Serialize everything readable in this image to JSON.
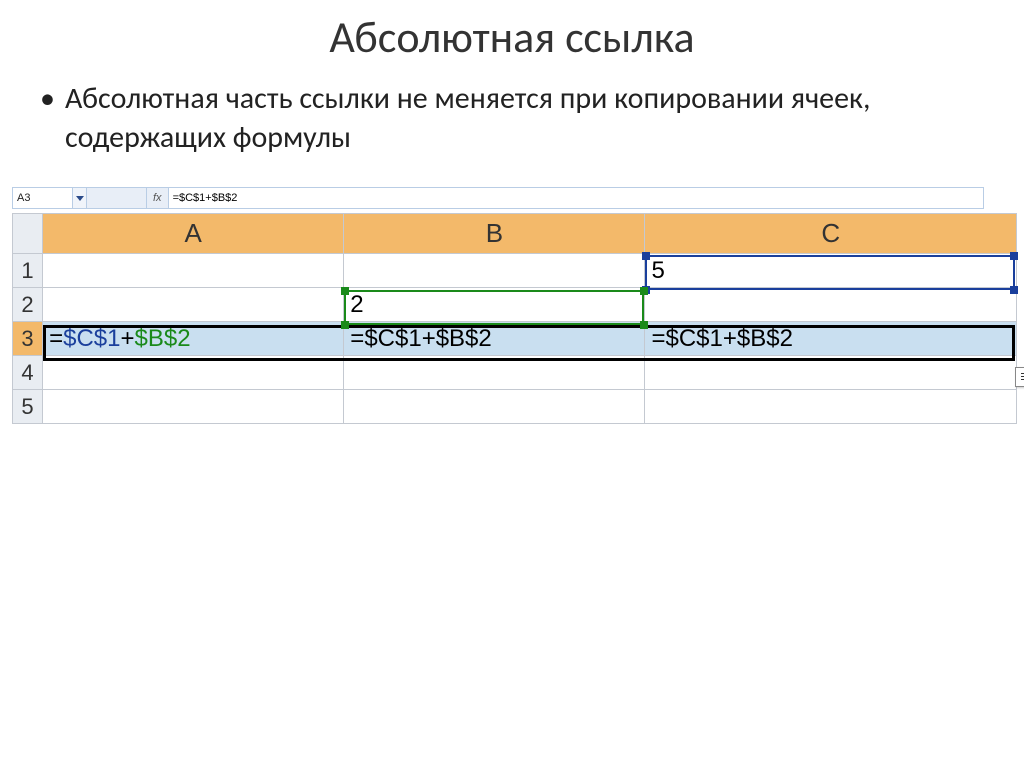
{
  "title": "Абсолютная ссылка",
  "bullet": "Абсолютная часть ссылки не меняется при копировании ячеек, содержащих формулы",
  "formula_bar": {
    "name_box": "A3",
    "fx_label": "fx",
    "formula": "=$C$1+$B$2"
  },
  "columns": [
    "A",
    "B",
    "C"
  ],
  "row_labels": [
    "1",
    "2",
    "3",
    "4",
    "5"
  ],
  "cells": {
    "c1": "5",
    "b2": "2",
    "a3_eq": "=",
    "a3_ref1": "$C$1",
    "a3_plus": "+",
    "a3_ref2": "$B$2",
    "b3": "=$C$1+$B$2",
    "c3": "=$C$1+$B$2"
  }
}
